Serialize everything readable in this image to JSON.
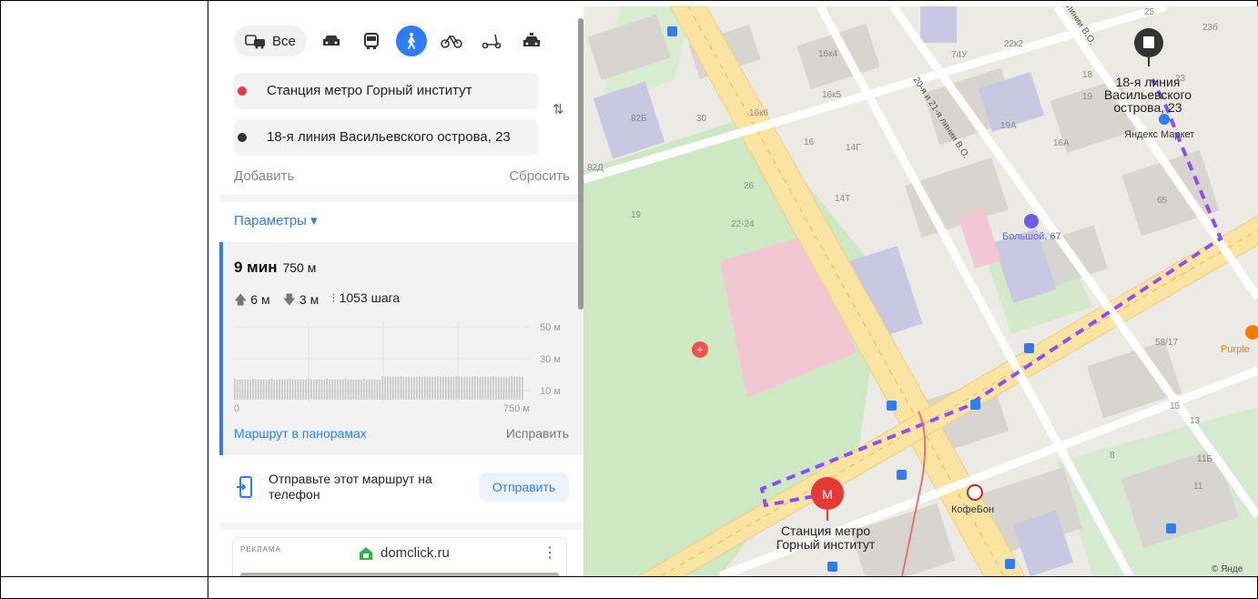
{
  "modes": {
    "all_label": "Все"
  },
  "route_points": {
    "from": "Станция метро Горный институт",
    "to": "18-я линия Васильевского острова, 23",
    "add": "Добавить",
    "reset": "Сбросить"
  },
  "params": {
    "label": "Параметры ▾"
  },
  "route": {
    "time": "9 мин",
    "distance": "750 м",
    "ascent": "6 м",
    "descent": "3 м",
    "steps": "1053 шага",
    "chart_y_labels": [
      "50 м",
      "30 м",
      "10 м"
    ],
    "chart_x_start": "0",
    "chart_x_end": "750 м",
    "panorama_link": "Маршрут в панорамах",
    "fix_link": "Исправить"
  },
  "send": {
    "text": "Отправьте этот маршрут на телефон",
    "button": "Отправить"
  },
  "ad": {
    "tag": "РЕКЛАМА",
    "brand": "domclick.ru",
    "more": "⋮"
  },
  "map": {
    "start_label_line1": "Станция метро",
    "start_label_line2": "Горный институт",
    "end_label_line1": "18-я линия",
    "end_label_line2": "Васильевского",
    "end_label_line3": "острова, 23",
    "poi_market": "Яндекс Маркет",
    "poi_bolshoy": "Большой, 67",
    "poi_kofebon": "КофеБон",
    "poi_purple": "Purple",
    "street_20_21": "20-я и 21-я линии В.О.",
    "street_top": "линии В.О.",
    "copyright": "© Янде",
    "house_numbers": [
      "16к4",
      "74У",
      "22к2",
      "25",
      "23б",
      "16к5",
      "18",
      "19",
      "23",
      "16к6",
      "82Б",
      "30",
      "19А",
      "16А",
      "16",
      "14Г",
      "82Д",
      "26",
      "14Т",
      "65",
      "19",
      "22-24",
      "58/17",
      "15",
      "13",
      "11Б",
      "8",
      "11"
    ]
  },
  "colors": {
    "accent": "#2e7cf6",
    "route": "#8a4dff",
    "start_pin": "#e53935",
    "end_pin": "#333333"
  }
}
